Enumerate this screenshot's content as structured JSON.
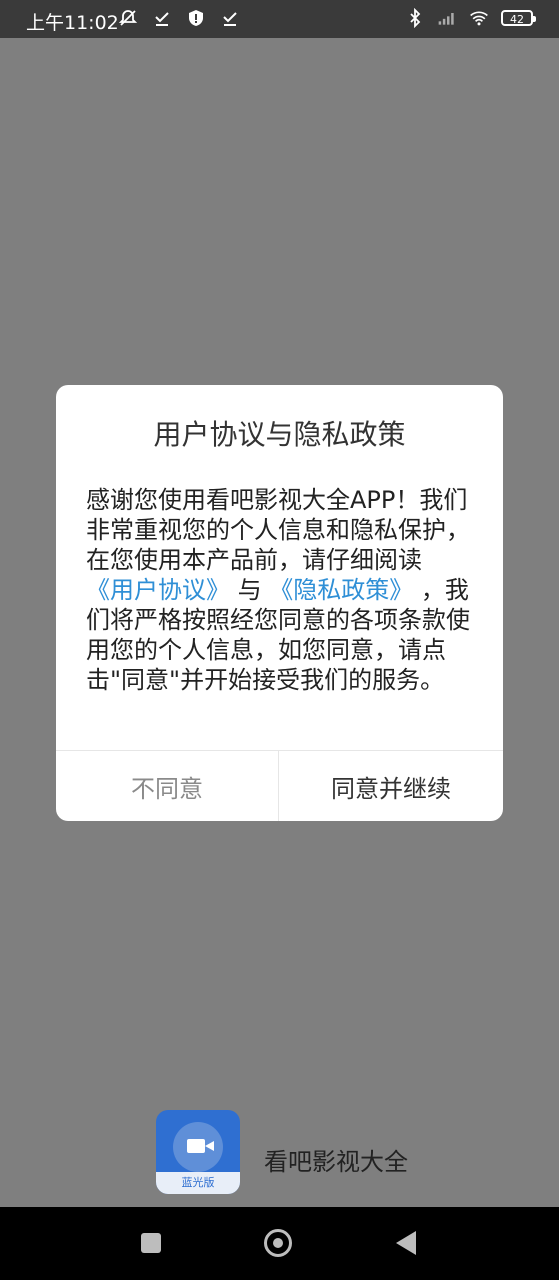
{
  "status_bar": {
    "time": "上午11:02",
    "battery": "42"
  },
  "dialog": {
    "title": "用户协议与隐私政策",
    "body_part1": "感谢您使用看吧影视大全APP！我们非常重视您的个人信息和隐私保护，在您使用本产品前，请仔细阅读",
    "link_user_agreement": "《用户协议》",
    "connector": "与",
    "link_privacy_policy": "《隐私政策》",
    "body_part2": "，我们将严格按照经您同意的各项条款使用您的个人信息，如您同意，请点击\"同意\"并开始接受我们的服务。",
    "decline_label": "不同意",
    "accept_label": "同意并继续"
  },
  "splash": {
    "app_name": "看吧影视大全",
    "badge_text": "蓝光版"
  },
  "colors": {
    "overlay": "#7f7f7f",
    "link": "#2f8fd6",
    "logo_blue": "#2f6fd1"
  },
  "icons": {
    "status_left": [
      "mute-icon",
      "check-icon",
      "shield-icon",
      "check-icon"
    ],
    "status_right": [
      "bluetooth-icon",
      "signal-icon",
      "wifi-icon",
      "battery-icon"
    ],
    "nav": [
      "recents-icon",
      "home-icon",
      "back-icon"
    ]
  }
}
